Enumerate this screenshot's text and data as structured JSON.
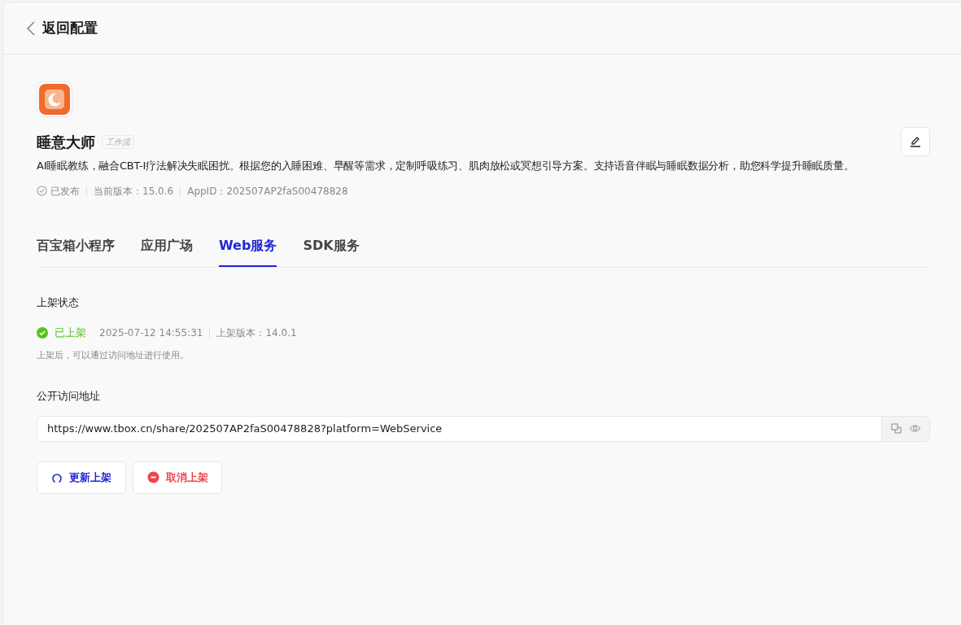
{
  "header": {
    "back_label": "返回配置"
  },
  "app": {
    "name": "睡意大师",
    "tag": "工作流",
    "description": "AI睡眠教练，融合CBT-I疗法解决失眠困扰。根据您的入睡困难、早醒等需求，定制呼吸练习、肌肉放松或冥想引导方案。支持语音伴眠与睡眠数据分析，助您科学提升睡眠质量。",
    "status": "已发布",
    "version": "当前版本：15.0.6",
    "app_id": "AppID：202507AP2faS00478828"
  },
  "tabs": [
    {
      "label": "百宝箱小程序",
      "selected": false
    },
    {
      "label": "应用广场",
      "selected": false
    },
    {
      "label": "Web服务",
      "selected": true
    },
    {
      "label": "SDK服务",
      "selected": false
    }
  ],
  "listing": {
    "title": "上架状态",
    "status": "已上架",
    "listed": true,
    "time": "2025-07-12 14:55:31",
    "version": "上架版本：14.0.1",
    "hint": "上架后，可以通过访问地址进行使用。"
  },
  "public_url": {
    "title": "公开访问地址",
    "value": "https://www.tbox.cn/share/202507AP2faS00478828?platform=WebService"
  },
  "buttons": [
    {
      "label": "更新上架",
      "kind": "update"
    },
    {
      "label": "取消上架",
      "kind": "cancel"
    }
  ]
}
